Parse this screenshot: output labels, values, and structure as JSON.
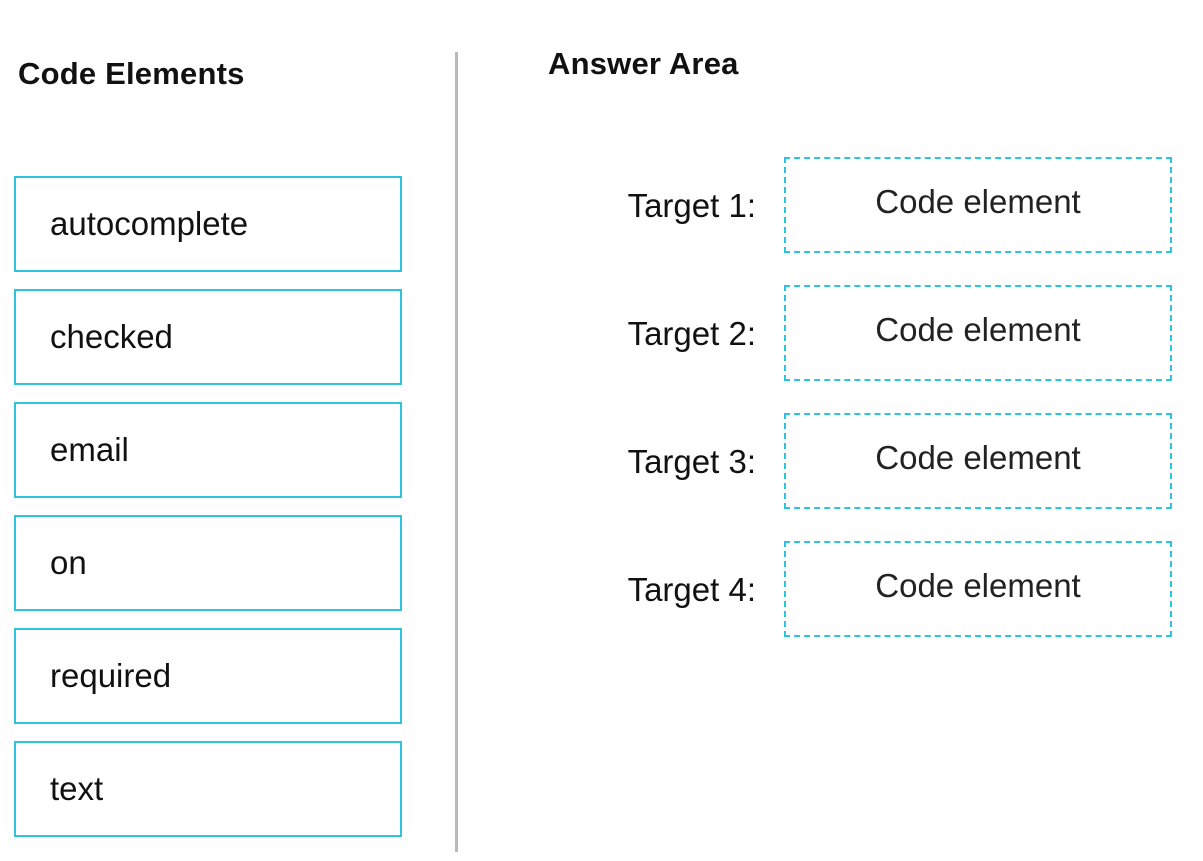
{
  "code_elements": {
    "heading": "Code Elements",
    "items": [
      {
        "label": "autocomplete"
      },
      {
        "label": "checked"
      },
      {
        "label": "email"
      },
      {
        "label": "on"
      },
      {
        "label": "required"
      },
      {
        "label": "text"
      }
    ]
  },
  "answer_area": {
    "heading": "Answer Area",
    "targets": [
      {
        "label": "Target 1:",
        "placeholder": "Code element"
      },
      {
        "label": "Target 2:",
        "placeholder": "Code element"
      },
      {
        "label": "Target 3:",
        "placeholder": "Code element"
      },
      {
        "label": "Target 4:",
        "placeholder": "Code element"
      }
    ]
  },
  "colors": {
    "box_border": "#2ec4e0",
    "divider": "#b9b9b9",
    "text": "#111111"
  }
}
